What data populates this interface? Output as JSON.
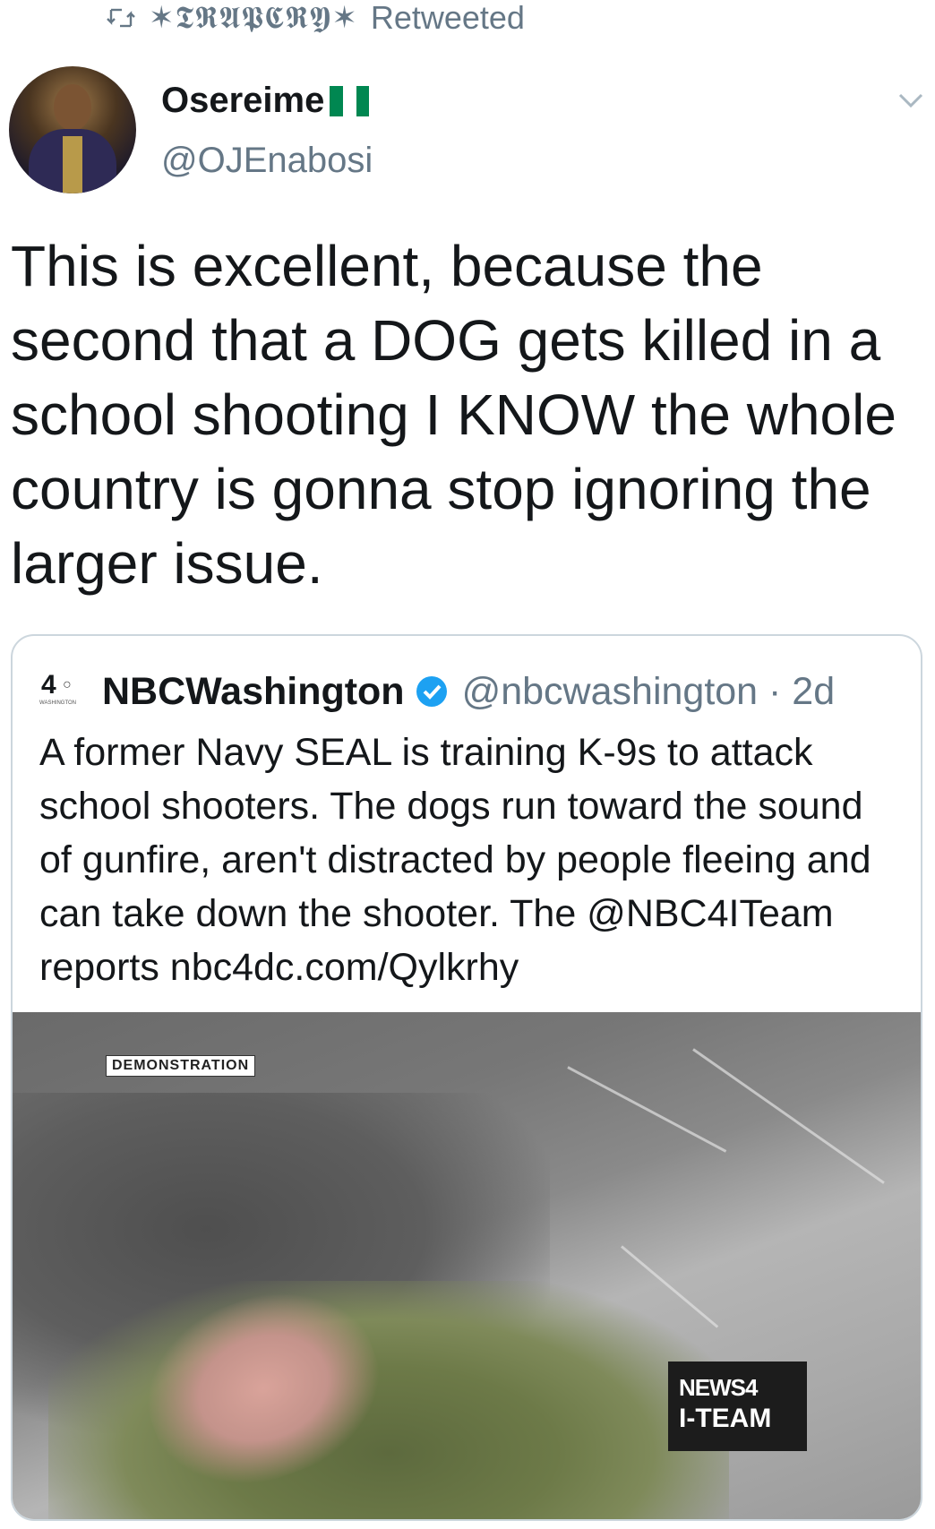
{
  "retweet": {
    "icon": "retweet-icon",
    "retweeter": "✶𝕿𝕽𝕬𝕻𝕮𝕽𝖄✶",
    "label": "Retweeted"
  },
  "author": {
    "display_name": "Osereime",
    "flag": "nigeria-flag-icon",
    "handle": "@OJEnabosi"
  },
  "tweet": {
    "text": "This is excellent, because the second that a DOG gets killed in a school shooting I KNOW the whole country is gonna stop ignoring the larger issue."
  },
  "quoted": {
    "logo_number": "4",
    "logo_caption": "WASHINGTON",
    "name": "NBCWashington",
    "handle_time": "@nbcwashington · 2d",
    "text": "A former Navy SEAL is training K-9s to attack school shooters. The dogs run toward the sound of gunfire, aren't distracted by people fleeing and can take down the shooter. The @NBC4ITeam reports nbc4dc.com/Qylkrhy",
    "media": {
      "label": "DEMONSTRATION",
      "badge_line1": "NEWS4",
      "badge_line2": "I-TEAM"
    }
  },
  "colors": {
    "text": "#14171a",
    "muted": "#657786",
    "border": "#ccd6dd",
    "verified": "#1da1f2",
    "flag_green": "#008751"
  }
}
